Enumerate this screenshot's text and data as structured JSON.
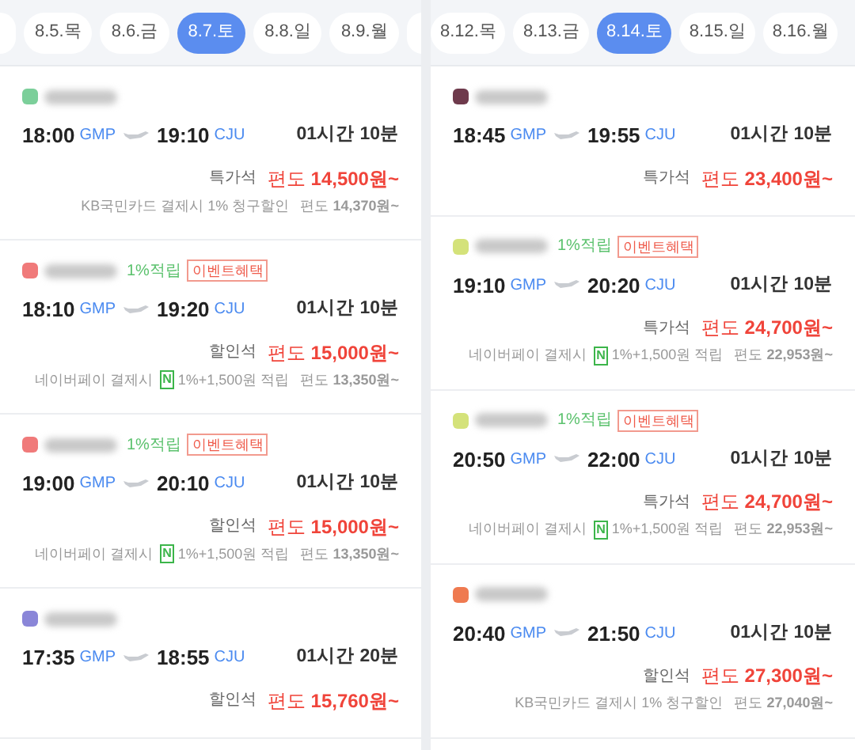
{
  "panels": [
    {
      "dates": [
        {
          "label": "8.5.목",
          "selected": false
        },
        {
          "label": "8.6.금",
          "selected": false
        },
        {
          "label": "8.7.토",
          "selected": true
        },
        {
          "label": "8.8.일",
          "selected": false
        },
        {
          "label": "8.9.월",
          "selected": false
        }
      ],
      "flights": [
        {
          "color": "#7ccf9a",
          "dep_time": "18:00",
          "dep_airport": "GMP",
          "arr_time": "19:10",
          "arr_airport": "CJU",
          "duration": "01시간 10분",
          "fare_class": "특가석",
          "price": "편도 **14,500원~**",
          "discount": {
            "text": "KB국민카드 결제시 1% 청구할인",
            "price": "편도 **14,370원~**"
          }
        },
        {
          "color": "#f07a7a",
          "points": "1%적립",
          "event": "이벤트혜택",
          "dep_time": "18:10",
          "dep_airport": "GMP",
          "arr_time": "19:20",
          "arr_airport": "CJU",
          "duration": "01시간 10분",
          "fare_class": "할인석",
          "price": "편도 **15,000원~**",
          "discount": {
            "text": "네이버페이 결제시",
            "badge": "N",
            "extra": "1%+1,500원 적립",
            "price": "편도 **13,350원~**"
          }
        },
        {
          "color": "#f07a7a",
          "points": "1%적립",
          "event": "이벤트혜택",
          "dep_time": "19:00",
          "dep_airport": "GMP",
          "arr_time": "20:10",
          "arr_airport": "CJU",
          "duration": "01시간 10분",
          "fare_class": "할인석",
          "price": "편도 **15,000원~**",
          "discount": {
            "text": "네이버페이 결제시",
            "badge": "N",
            "extra": "1%+1,500원 적립",
            "price": "편도 **13,350원~**"
          }
        },
        {
          "color": "#8a86d8",
          "dep_time": "17:35",
          "dep_airport": "GMP",
          "arr_time": "18:55",
          "arr_airport": "CJU",
          "duration": "01시간 20분",
          "fare_class": "할인석",
          "price": "편도 **15,760원~**"
        }
      ]
    },
    {
      "dates": [
        {
          "label": "8.12.목",
          "selected": false
        },
        {
          "label": "8.13.금",
          "selected": false
        },
        {
          "label": "8.14.토",
          "selected": true
        },
        {
          "label": "8.15.일",
          "selected": false
        },
        {
          "label": "8.16.월",
          "selected": false
        }
      ],
      "flights": [
        {
          "color": "#6e3a4c",
          "dep_time": "18:45",
          "dep_airport": "GMP",
          "arr_time": "19:55",
          "arr_airport": "CJU",
          "duration": "01시간 10분",
          "fare_class": "특가석",
          "price": "편도 **23,400원~**"
        },
        {
          "color": "#d4e27a",
          "points": "1%적립",
          "event": "이벤트혜택",
          "dep_time": "19:10",
          "dep_airport": "GMP",
          "arr_time": "20:20",
          "arr_airport": "CJU",
          "duration": "01시간 10분",
          "fare_class": "특가석",
          "price": "편도 **24,700원~**",
          "discount": {
            "text": "네이버페이 결제시",
            "badge": "N",
            "extra": "1%+1,500원 적립",
            "price": "편도 **22,953원~**"
          }
        },
        {
          "color": "#d4e27a",
          "points": "1%적립",
          "event": "이벤트혜택",
          "dep_time": "20:50",
          "dep_airport": "GMP",
          "arr_time": "22:00",
          "arr_airport": "CJU",
          "duration": "01시간 10분",
          "fare_class": "특가석",
          "price": "편도 **24,700원~**",
          "discount": {
            "text": "네이버페이 결제시",
            "badge": "N",
            "extra": "1%+1,500원 적립",
            "price": "편도 **22,953원~**"
          }
        },
        {
          "color": "#ef7a50",
          "dep_time": "20:40",
          "dep_airport": "GMP",
          "arr_time": "21:50",
          "arr_airport": "CJU",
          "duration": "01시간 10분",
          "fare_class": "할인석",
          "price": "편도 **27,300원~**",
          "discount": {
            "text": "KB국민카드 결제시 1% 청구할인",
            "price": "편도 **27,040원~**"
          }
        }
      ]
    }
  ]
}
